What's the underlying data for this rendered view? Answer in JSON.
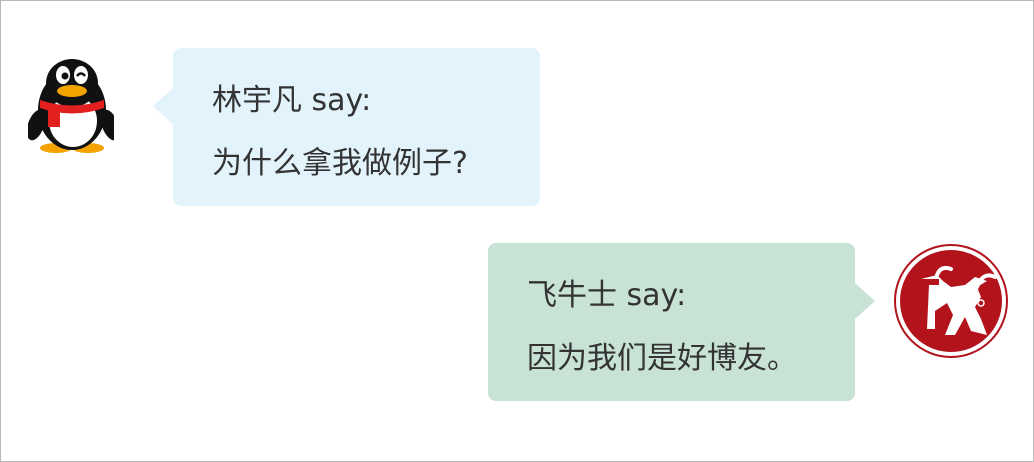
{
  "messages": [
    {
      "side": "left",
      "sender_line": "林宇凡 say:",
      "text": "为什么拿我做例子?",
      "bubble_color": "#e3f3fc",
      "avatar_icon": "penguin-avatar-icon"
    },
    {
      "side": "right",
      "sender_line": "飞牛士 say:",
      "text": "因为我们是好博友。",
      "bubble_color": "#c8e3d5",
      "avatar_icon": "bull-logo-avatar-icon"
    }
  ],
  "colors": {
    "text": "#333333",
    "border": "#b9b9b9",
    "bull_logo_red": "#b3131b"
  }
}
